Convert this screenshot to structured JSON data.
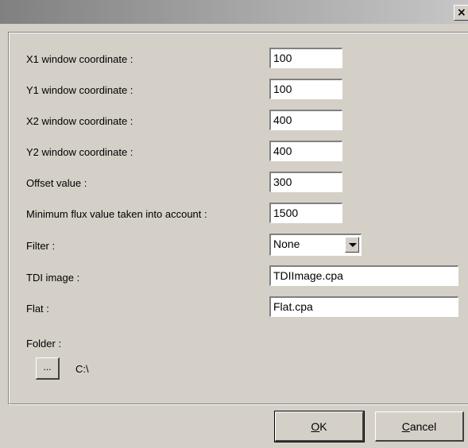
{
  "window": {
    "close_glyph": "×"
  },
  "fields": [
    {
      "label": "X1 window coordinate :",
      "value": "100"
    },
    {
      "label": "Y1 window coordinate :",
      "value": "100"
    },
    {
      "label": "X2 window coordinate :",
      "value": "400"
    },
    {
      "label": "Y2 window coordinate :",
      "value": "400"
    },
    {
      "label": "Offset value :",
      "value": "300"
    },
    {
      "label": "Minimum flux value taken into account :",
      "value": "1500"
    }
  ],
  "filter": {
    "label": "Filter :",
    "selected": "None"
  },
  "tdi_image": {
    "label": "TDI image :",
    "value": "TDIImage.cpa"
  },
  "flat": {
    "label": "Flat :",
    "value": "Flat.cpa"
  },
  "folder": {
    "label": "Folder :",
    "browse_label": "...",
    "path": "C:\\"
  },
  "buttons": {
    "ok_mnemonic": "O",
    "ok_rest": "K",
    "cancel_mnemonic": "C",
    "cancel_rest": "ancel"
  },
  "colors": {
    "dialog_bg": "#d4d0c8",
    "titlebar_start": "#808080",
    "titlebar_end": "#c6c6c6"
  }
}
